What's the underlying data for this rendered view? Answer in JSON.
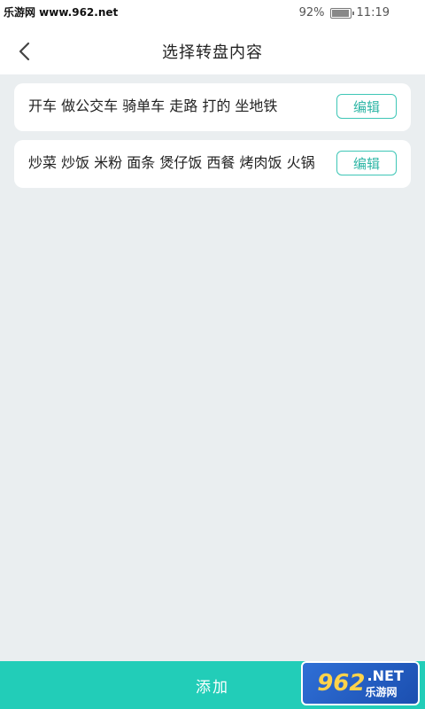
{
  "status_bar": {
    "watermark": "乐游网 www.962.net",
    "battery": "92%",
    "time": "11:19"
  },
  "header": {
    "title": "选择转盘内容",
    "back_icon": "chevron-left-icon"
  },
  "items": [
    {
      "text": "开车 做公交车 骑单车 走路 打的 坐地铁",
      "edit_label": "编辑"
    },
    {
      "text": "炒菜 炒饭 米粉 面条 煲仔饭 西餐 烤肉饭 火锅",
      "edit_label": "编辑"
    }
  ],
  "bottom": {
    "add_label": "添加"
  },
  "logo": {
    "num": "962",
    "net": ".NET",
    "sub": "乐游网"
  },
  "colors": {
    "accent": "#22cdb8",
    "edit_border": "#3ec6b6",
    "background": "#eaeef0"
  }
}
